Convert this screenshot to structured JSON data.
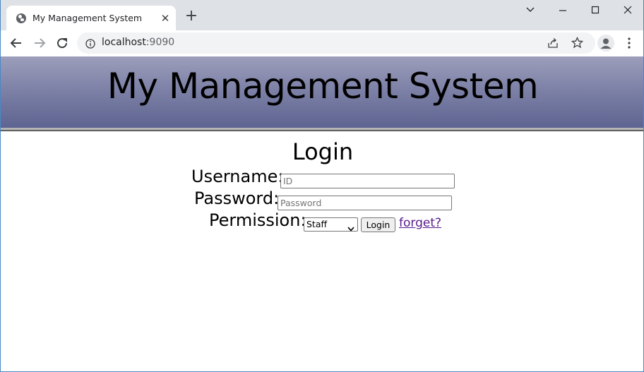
{
  "browser": {
    "tab": {
      "title": "My Management System",
      "close_glyph": "✕",
      "favicon": "globe-icon"
    },
    "new_tab_glyph": "+",
    "window_controls": {
      "dropdown": "chevron-down-icon",
      "minimize": "minimize-icon",
      "maximize": "maximize-icon",
      "close": "close-icon"
    },
    "address": {
      "host": "localhost",
      "port": ":9090"
    },
    "toolbar_icons": [
      "back-icon",
      "forward-icon",
      "reload-icon",
      "info-icon",
      "share-icon",
      "star-icon",
      "profile-icon",
      "menu-icon"
    ]
  },
  "page": {
    "banner_title": "My Management System",
    "login_heading": "Login",
    "form": {
      "username_label": "Username:",
      "username_placeholder": "ID",
      "password_label": "Password:",
      "password_placeholder": "Password",
      "permission_label": "Permission:",
      "permission_selected": "Staff",
      "login_button": "Login",
      "forget_link": "forget?"
    }
  },
  "colors": {
    "banner_top": "#9c9ebb",
    "banner_bottom": "#5e6491",
    "link_visited": "#551a8b",
    "tabstrip_bg": "#dee1e6"
  }
}
